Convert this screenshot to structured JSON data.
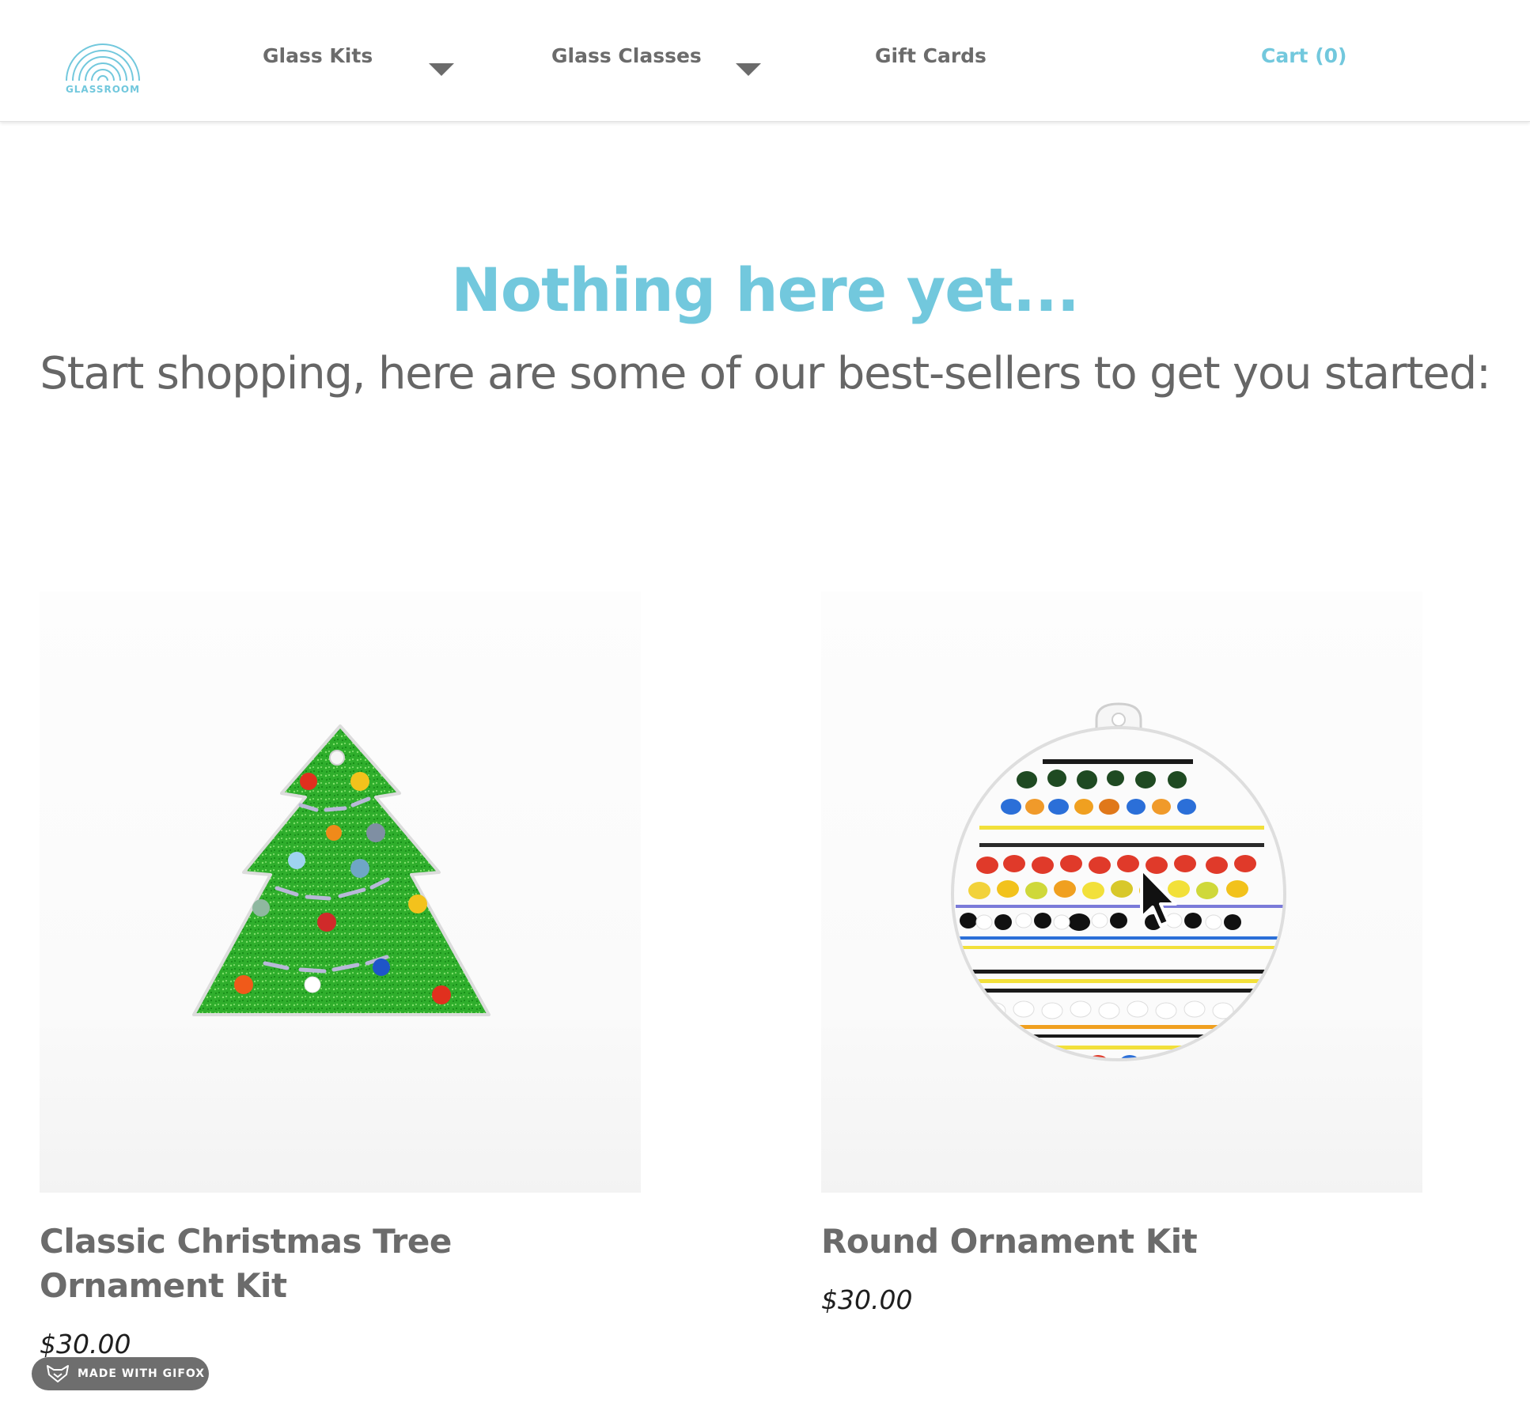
{
  "header": {
    "logo_text": "GLASSROOM",
    "nav": [
      {
        "label": "Glass Kits",
        "has_dropdown": true
      },
      {
        "label": "Glass Classes",
        "has_dropdown": true
      },
      {
        "label": "Gift Cards",
        "has_dropdown": false
      }
    ],
    "cart_label": "Cart (0)"
  },
  "empty_state": {
    "title": "Nothing here yet...",
    "subtitle": "Start shopping, here are some of our best-sellers to get you started:"
  },
  "products": [
    {
      "title": "Classic Christmas Tree Ornament Kit",
      "price": "$30.00",
      "image_icon": "christmas-tree-ornament"
    },
    {
      "title": "Round Ornament Kit",
      "price": "$30.00",
      "image_icon": "round-ornament"
    }
  ],
  "badge": {
    "label": "MADE WITH GIFOX",
    "icon": "fox-icon"
  },
  "colors": {
    "accent": "#72c8dd",
    "nav_text": "#6b6b6b",
    "body_text": "#666666",
    "price_text": "#1e1e1e"
  }
}
